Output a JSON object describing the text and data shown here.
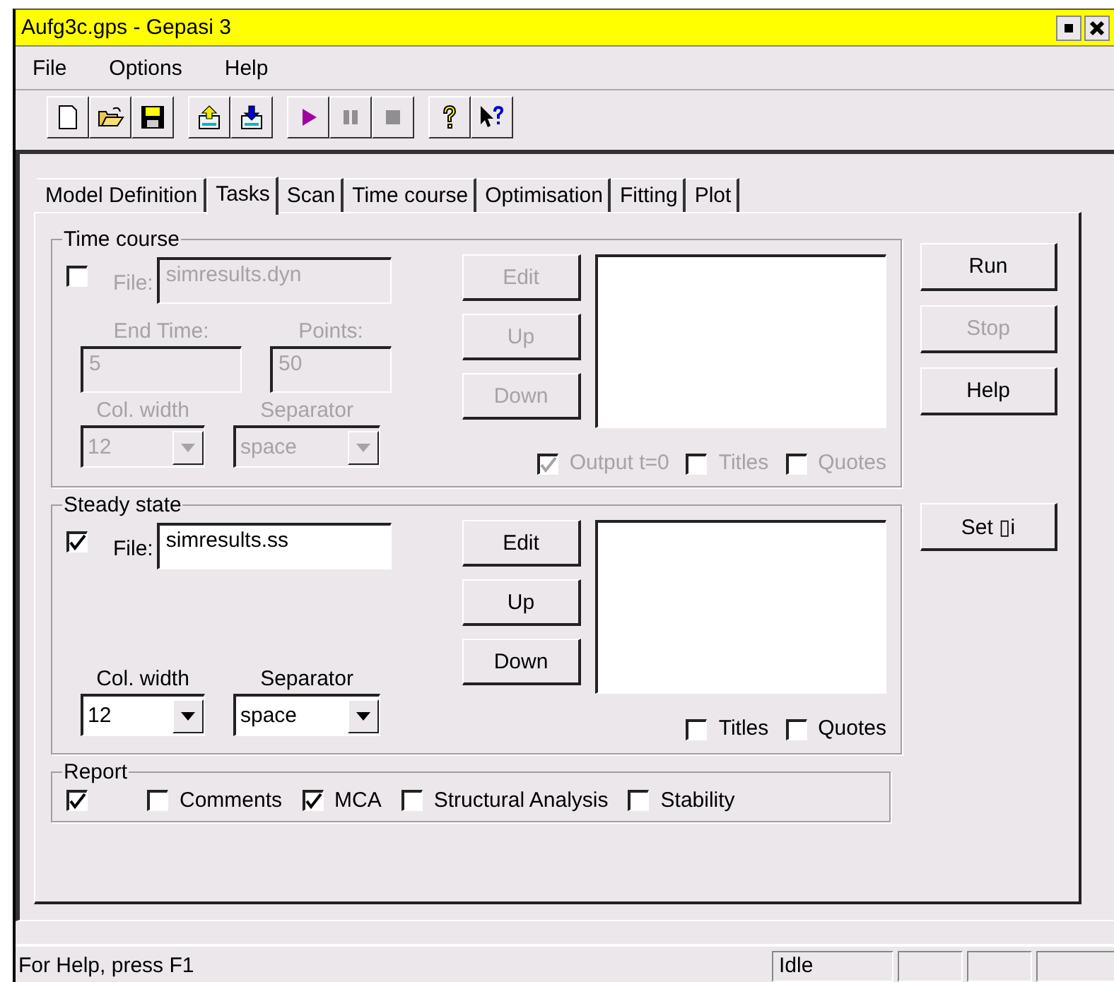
{
  "window": {
    "title": "Aufg3c.gps - Gepasi 3"
  },
  "menu": [
    {
      "label": "File"
    },
    {
      "label": "Options"
    },
    {
      "label": "Help"
    }
  ],
  "toolbar": [
    {
      "kind": "new",
      "disabled": false
    },
    {
      "kind": "open",
      "disabled": false
    },
    {
      "kind": "save",
      "disabled": false
    },
    {
      "kind": "sep"
    },
    {
      "kind": "export",
      "disabled": false
    },
    {
      "kind": "import",
      "disabled": false
    },
    {
      "kind": "sep"
    },
    {
      "kind": "play",
      "disabled": false
    },
    {
      "kind": "pause",
      "disabled": true
    },
    {
      "kind": "stop",
      "disabled": true
    },
    {
      "kind": "sep"
    },
    {
      "kind": "help",
      "disabled": false
    },
    {
      "kind": "context-help",
      "disabled": false
    }
  ],
  "tabs": [
    {
      "label": "Model Definition",
      "selected": false
    },
    {
      "label": "Tasks",
      "selected": true
    },
    {
      "label": "Scan",
      "selected": false
    },
    {
      "label": "Time course",
      "selected": false
    },
    {
      "label": "Optimisation",
      "selected": false
    },
    {
      "label": "Fitting",
      "selected": false
    },
    {
      "label": "Plot",
      "selected": false
    }
  ],
  "time_course": {
    "title": "Time course",
    "disabled": true,
    "checked": false,
    "file_label": "File:",
    "file_value": "simresults.dyn",
    "end_time_label": "End Time:",
    "end_time_value": "5",
    "points_label": "Points:",
    "points_value": "50",
    "col_width_label": "Col. width",
    "col_width_value": "12",
    "separator_label": "Separator",
    "separator_value": "space",
    "buttons": [
      "Edit",
      "Up",
      "Down"
    ],
    "options": [
      {
        "label": "Output t=0",
        "checked": true
      },
      {
        "label": "Titles",
        "checked": false
      },
      {
        "label": "Quotes",
        "checked": false
      }
    ]
  },
  "steady_state": {
    "title": "Steady state",
    "disabled": false,
    "checked": true,
    "file_label": "File:",
    "file_value": "simresults.ss",
    "col_width_label": "Col. width",
    "col_width_value": "12",
    "separator_label": "Separator",
    "separator_value": "space",
    "buttons": [
      "Edit",
      "Up",
      "Down"
    ],
    "options": [
      {
        "label": "Titles",
        "checked": false
      },
      {
        "label": "Quotes",
        "checked": false
      }
    ]
  },
  "report": {
    "title": "Report",
    "checked": true,
    "options": [
      {
        "label": "Comments",
        "checked": false
      },
      {
        "label": "MCA",
        "checked": true
      },
      {
        "label": "Structural Analysis",
        "checked": false
      },
      {
        "label": "Stability",
        "checked": false
      }
    ]
  },
  "side_buttons": [
    {
      "label": "Run",
      "disabled": false
    },
    {
      "label": "Stop",
      "disabled": true
    },
    {
      "label": "Help",
      "disabled": false
    },
    {
      "label": "Set ▯i",
      "disabled": false
    }
  ],
  "status_bar": {
    "message": "For Help, press F1",
    "state": "Idle"
  }
}
